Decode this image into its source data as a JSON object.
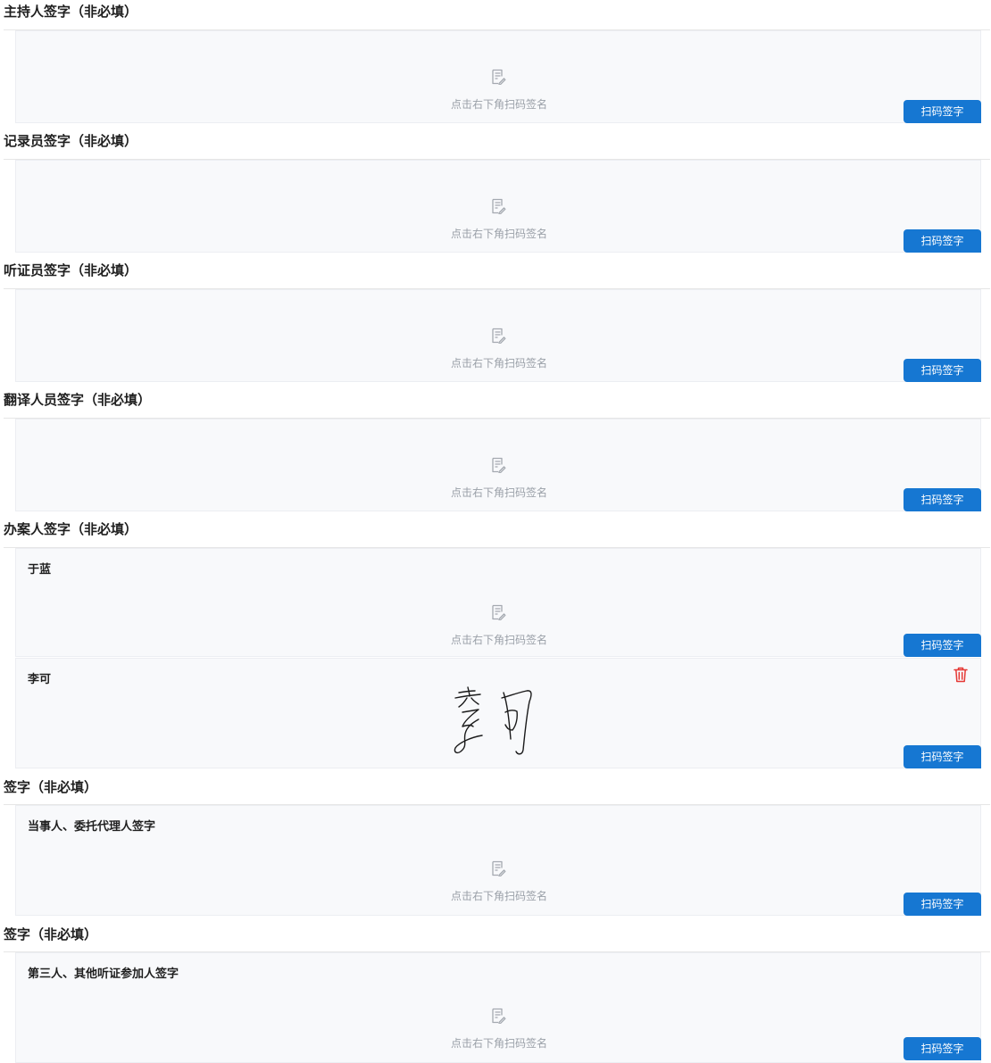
{
  "common": {
    "placeholder_text": "点击右下角扫码签名",
    "scan_button_label": "扫码签字",
    "placeholder_icon": "sign-edit-icon",
    "delete_icon": "trash-icon",
    "accent_color": "#1677d2",
    "delete_color": "#e53935"
  },
  "sections": [
    {
      "title": "主持人签字（非必填）",
      "boxes": [
        {
          "label": "",
          "signed": false
        }
      ]
    },
    {
      "title": "记录员签字（非必填）",
      "boxes": [
        {
          "label": "",
          "signed": false
        }
      ]
    },
    {
      "title": "听证员签字（非必填）",
      "boxes": [
        {
          "label": "",
          "signed": false
        }
      ]
    },
    {
      "title": "翻译人员签字（非必填）",
      "boxes": [
        {
          "label": "",
          "signed": false
        }
      ]
    },
    {
      "title": "办案人签字（非必填）",
      "boxes": [
        {
          "label": "于蓝",
          "signed": false
        },
        {
          "label": "李可",
          "signed": true
        }
      ]
    },
    {
      "title": "签字（非必填）",
      "boxes": [
        {
          "label": "当事人、委托代理人签字",
          "signed": false
        }
      ]
    },
    {
      "title": "签字（非必填）",
      "boxes": [
        {
          "label": "第三人、其他听证参加人签字",
          "signed": false
        }
      ]
    }
  ]
}
